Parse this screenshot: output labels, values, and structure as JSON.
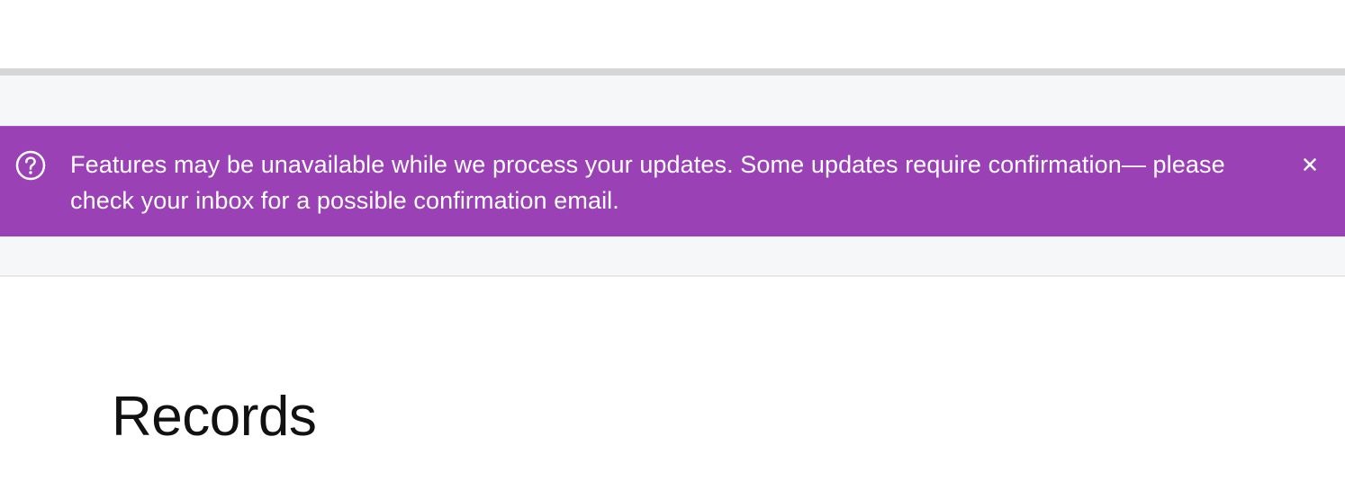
{
  "notification": {
    "message": "Features may be unavailable while we process your updates. Some updates require confirmation— please check your inbox for a possible confirmation email.",
    "icon": "help-circle-icon",
    "close_icon": "close-icon",
    "background_color": "#9b41b6",
    "text_color": "#ffffff"
  },
  "page": {
    "title": "Records"
  }
}
